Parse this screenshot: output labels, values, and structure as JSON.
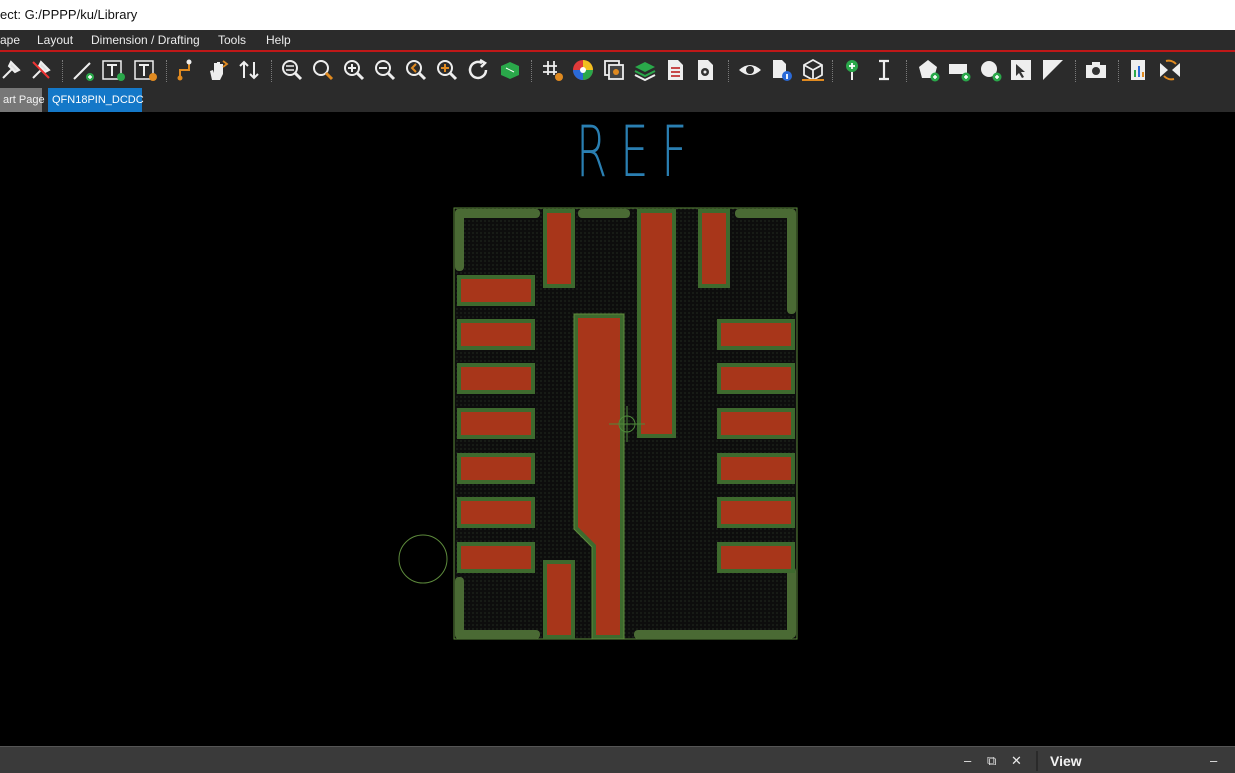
{
  "titlebar": {
    "text": "ect: G:/PPPP/ku/Library"
  },
  "menu": {
    "items": [
      {
        "label": "ape"
      },
      {
        "label": "Layout"
      },
      {
        "label": "Dimension / Drafting"
      },
      {
        "label": "Tools"
      },
      {
        "label": "Help"
      }
    ]
  },
  "toolbar": {
    "icons": [
      "pin-icon",
      "unpin-icon",
      "draw-line-icon",
      "add-text-icon",
      "edit-text-icon",
      "route-icon",
      "hand-move-icon",
      "swap-icon",
      "zoom-window-icon",
      "zoom-search-icon",
      "zoom-in-icon",
      "zoom-out-icon",
      "zoom-previous-icon",
      "zoom-fit-icon",
      "refresh-icon",
      "board-icon",
      "grid-settings-icon",
      "color-wheel-icon",
      "layer-view-icon",
      "layers-icon",
      "report-icon",
      "settings-doc-icon",
      "eye-icon",
      "info-doc-icon",
      "3d-box-icon",
      "add-pin-icon",
      "text-cursor-icon",
      "add-polygon-icon",
      "add-rectangle-icon",
      "add-circle-icon",
      "select-icon",
      "contrast-icon",
      "camera-icon",
      "chart-report-icon",
      "switch-icon"
    ]
  },
  "tabs": {
    "start_label": "art Page",
    "active_label": "QFN18PIN_DCDC"
  },
  "canvas": {
    "ref_label": "REF",
    "colors": {
      "pad_fill": "#a8361a",
      "pad_outline": "#3e6a2e",
      "body_fill": "#121212",
      "ref_text": "#2a7fb2",
      "silk": "#5d8a3c"
    }
  },
  "bottom": {
    "minimize": "–",
    "restore": "⧉",
    "close": "✕",
    "view_label": "View",
    "panel_minimize": "–"
  }
}
